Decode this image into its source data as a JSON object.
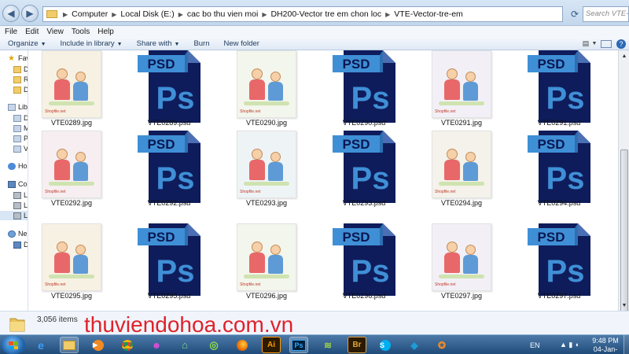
{
  "address": {
    "crumbs": [
      "Computer",
      "Local Disk (E:)",
      "cac bo thu vien moi",
      "DH200-Vector tre em chon loc",
      "VTE-Vector-tre-em"
    ],
    "search_placeholder": "Search VTE-..."
  },
  "menu": [
    "File",
    "Edit",
    "View",
    "Tools",
    "Help"
  ],
  "commands": {
    "organize": "Organize",
    "include": "Include in library",
    "share": "Share with",
    "burn": "Burn",
    "new_folder": "New folder"
  },
  "nav": {
    "favorites": "Fav",
    "fav_items": [
      "D",
      "R",
      "D"
    ],
    "libraries": "Libr",
    "lib_items": [
      "D",
      "M",
      "P",
      "V"
    ],
    "homegroup": "Ho",
    "computer": "Co",
    "drives": [
      "L",
      "L",
      "L"
    ],
    "network": "Ne",
    "net_items": [
      "D"
    ]
  },
  "files": {
    "row1": [
      "VTE0289.jpg",
      "VTE0289.psd",
      "VTE0290.jpg",
      "VTE0290.psd",
      "VTE0291.jpg",
      "VTE0291.psd"
    ],
    "row2": [
      "VTE0292.jpg",
      "VTE0292.psd",
      "VTE0293.jpg",
      "VTE0293.psd",
      "VTE0294.jpg",
      "VTE0294.psd"
    ],
    "row3": [
      "VTE0295.jpg",
      "VTE0295.psd",
      "VTE0296.jpg",
      "VTE0296.psd",
      "VTE0297.jpg",
      "VTE0297.psd"
    ]
  },
  "psd_label": "PSD",
  "ps_label": "Ps",
  "thumb_watermark": "Shopfile.net",
  "details": {
    "count": "3,056 items"
  },
  "site_watermark": "thuviendohoa.com.vn",
  "taskbar": {
    "apps": [
      "Ai",
      "Ps",
      "Br"
    ],
    "lang": "EN",
    "time": "9:48 PM",
    "date": "04-Jan-16"
  },
  "colors": {
    "psd_blue": "#0f1c5b",
    "psd_light": "#3f8fd6",
    "watermark_red": "#e0222b"
  }
}
